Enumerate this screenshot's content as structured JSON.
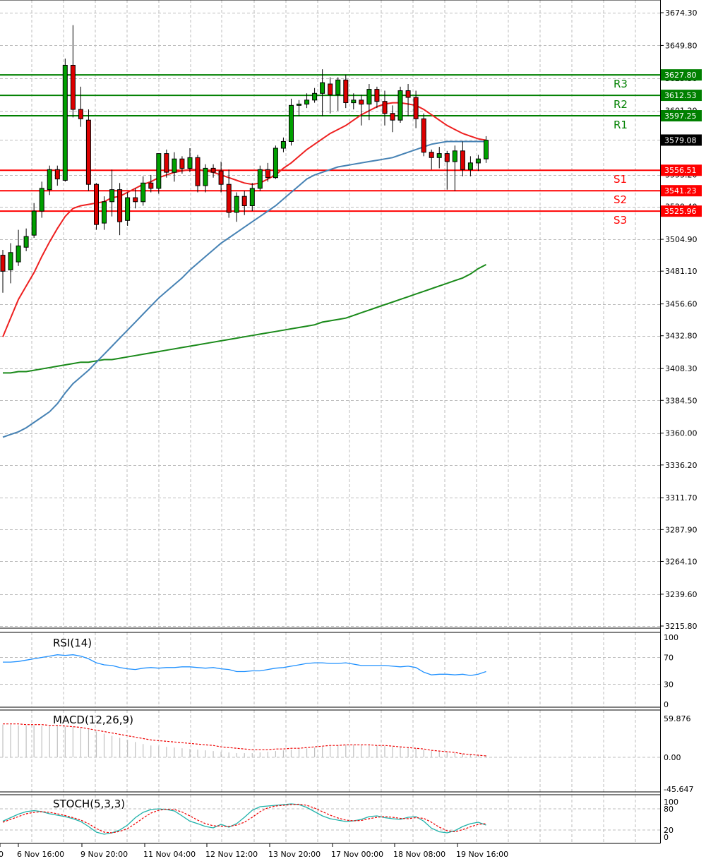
{
  "chart_data": {
    "type": "candlestick",
    "instrument_note": "",
    "time_axis_labels": [
      "0",
      "6 Nov 16:00",
      "9 Nov 20:00",
      "11 Nov 04:00",
      "12 Nov 12:00",
      "13 Nov 20:00",
      "17 Nov 00:00",
      "18 Nov 08:00",
      "19 Nov 16:00"
    ],
    "price_axis_labels": [
      "3674.30",
      "3649.80",
      "3625.30",
      "3601.20",
      "3579.08",
      "3553.20",
      "3529.40",
      "3504.90",
      "3481.10",
      "3456.60",
      "3432.80",
      "3408.30",
      "3384.50",
      "3360.00",
      "3336.20",
      "3311.70",
      "3287.90",
      "3264.10",
      "3239.60",
      "3215.80"
    ],
    "price_range": [
      3215.8,
      3674.3
    ],
    "current_price": {
      "label": "3579.08",
      "value": 3579.08
    },
    "levels": [
      {
        "name": "R3",
        "value": 3627.8,
        "label": "3627.80",
        "color": "#008000"
      },
      {
        "name": "R2",
        "value": 3612.53,
        "label": "3612.53",
        "color": "#008000"
      },
      {
        "name": "R1",
        "value": 3597.25,
        "label": "3597.25",
        "color": "#008000"
      },
      {
        "name": "S1",
        "value": 3556.51,
        "label": "3556.51",
        "color": "#ff0000"
      },
      {
        "name": "S2",
        "value": 3541.23,
        "label": "3541.23",
        "color": "#ff0000"
      },
      {
        "name": "S3",
        "value": 3525.96,
        "label": "3525.96",
        "color": "#ff0000"
      }
    ],
    "candles": [
      {
        "o": 3493,
        "h": 3497,
        "l": 3465,
        "c": 3481
      },
      {
        "o": 3482,
        "h": 3502,
        "l": 3472,
        "c": 3495
      },
      {
        "o": 3488,
        "h": 3512,
        "l": 3485,
        "c": 3500
      },
      {
        "o": 3499,
        "h": 3513,
        "l": 3496,
        "c": 3507
      },
      {
        "o": 3508,
        "h": 3532,
        "l": 3506,
        "c": 3526
      },
      {
        "o": 3526,
        "h": 3548,
        "l": 3521,
        "c": 3543
      },
      {
        "o": 3542,
        "h": 3560,
        "l": 3538,
        "c": 3557
      },
      {
        "o": 3557,
        "h": 3560,
        "l": 3545,
        "c": 3550
      },
      {
        "o": 3549,
        "h": 3640,
        "l": 3548,
        "c": 3635
      },
      {
        "o": 3635,
        "h": 3665,
        "l": 3596,
        "c": 3602
      },
      {
        "o": 3602,
        "h": 3619,
        "l": 3589,
        "c": 3595
      },
      {
        "o": 3594,
        "h": 3602,
        "l": 3541,
        "c": 3546
      },
      {
        "o": 3546,
        "h": 3547,
        "l": 3512,
        "c": 3516
      },
      {
        "o": 3517,
        "h": 3537,
        "l": 3512,
        "c": 3533
      },
      {
        "o": 3533,
        "h": 3557,
        "l": 3522,
        "c": 3542
      },
      {
        "o": 3542,
        "h": 3547,
        "l": 3508,
        "c": 3518
      },
      {
        "o": 3519,
        "h": 3540,
        "l": 3515,
        "c": 3536
      },
      {
        "o": 3536,
        "h": 3543,
        "l": 3528,
        "c": 3533
      },
      {
        "o": 3533,
        "h": 3552,
        "l": 3530,
        "c": 3547
      },
      {
        "o": 3547,
        "h": 3553,
        "l": 3540,
        "c": 3543
      },
      {
        "o": 3543,
        "h": 3560,
        "l": 3539,
        "c": 3569
      },
      {
        "o": 3569,
        "h": 3572,
        "l": 3551,
        "c": 3555
      },
      {
        "o": 3555,
        "h": 3570,
        "l": 3548,
        "c": 3565
      },
      {
        "o": 3565,
        "h": 3567,
        "l": 3554,
        "c": 3558
      },
      {
        "o": 3558,
        "h": 3573,
        "l": 3555,
        "c": 3566
      },
      {
        "o": 3566,
        "h": 3568,
        "l": 3540,
        "c": 3545
      },
      {
        "o": 3545,
        "h": 3561,
        "l": 3540,
        "c": 3558
      },
      {
        "o": 3558,
        "h": 3561,
        "l": 3551,
        "c": 3555
      },
      {
        "o": 3556,
        "h": 3563,
        "l": 3540,
        "c": 3546
      },
      {
        "o": 3546,
        "h": 3557,
        "l": 3521,
        "c": 3525
      },
      {
        "o": 3525,
        "h": 3540,
        "l": 3518,
        "c": 3537
      },
      {
        "o": 3537,
        "h": 3541,
        "l": 3523,
        "c": 3530
      },
      {
        "o": 3530,
        "h": 3547,
        "l": 3526,
        "c": 3543
      },
      {
        "o": 3543,
        "h": 3560,
        "l": 3541,
        "c": 3557
      },
      {
        "o": 3557,
        "h": 3562,
        "l": 3548,
        "c": 3551
      },
      {
        "o": 3551,
        "h": 3575,
        "l": 3550,
        "c": 3573
      },
      {
        "o": 3573,
        "h": 3581,
        "l": 3570,
        "c": 3578
      },
      {
        "o": 3578,
        "h": 3610,
        "l": 3575,
        "c": 3605
      },
      {
        "o": 3605,
        "h": 3609,
        "l": 3597,
        "c": 3606
      },
      {
        "o": 3606,
        "h": 3614,
        "l": 3603,
        "c": 3609
      },
      {
        "o": 3609,
        "h": 3618,
        "l": 3607,
        "c": 3614
      },
      {
        "o": 3614,
        "h": 3632,
        "l": 3597,
        "c": 3622
      },
      {
        "o": 3621,
        "h": 3626,
        "l": 3599,
        "c": 3613
      },
      {
        "o": 3613,
        "h": 3626,
        "l": 3601,
        "c": 3624
      },
      {
        "o": 3624,
        "h": 3628,
        "l": 3603,
        "c": 3607
      },
      {
        "o": 3607,
        "h": 3614,
        "l": 3602,
        "c": 3609
      },
      {
        "o": 3609,
        "h": 3613,
        "l": 3590,
        "c": 3606
      },
      {
        "o": 3606,
        "h": 3621,
        "l": 3594,
        "c": 3617
      },
      {
        "o": 3617,
        "h": 3619,
        "l": 3603,
        "c": 3608
      },
      {
        "o": 3608,
        "h": 3616,
        "l": 3590,
        "c": 3599
      },
      {
        "o": 3599,
        "h": 3605,
        "l": 3585,
        "c": 3594
      },
      {
        "o": 3594,
        "h": 3619,
        "l": 3592,
        "c": 3616
      },
      {
        "o": 3616,
        "h": 3621,
        "l": 3597,
        "c": 3611
      },
      {
        "o": 3611,
        "h": 3616,
        "l": 3588,
        "c": 3595
      },
      {
        "o": 3595,
        "h": 3599,
        "l": 3567,
        "c": 3570
      },
      {
        "o": 3570,
        "h": 3572,
        "l": 3557,
        "c": 3566
      },
      {
        "o": 3566,
        "h": 3574,
        "l": 3558,
        "c": 3569
      },
      {
        "o": 3569,
        "h": 3571,
        "l": 3542,
        "c": 3563
      },
      {
        "o": 3563,
        "h": 3575,
        "l": 3541,
        "c": 3571
      },
      {
        "o": 3571,
        "h": 3578,
        "l": 3552,
        "c": 3557
      },
      {
        "o": 3557,
        "h": 3567,
        "l": 3552,
        "c": 3562
      },
      {
        "o": 3562,
        "h": 3568,
        "l": 3556,
        "c": 3565
      },
      {
        "o": 3565,
        "h": 3582,
        "l": 3562,
        "c": 3579
      }
    ],
    "ma_red": [
      3432,
      3446,
      3460,
      3470,
      3480,
      3492,
      3503,
      3513,
      3522,
      3528,
      3530,
      3531,
      3532,
      3533,
      3536,
      3537,
      3540,
      3543,
      3546,
      3548,
      3551,
      3553,
      3555,
      3556,
      3557,
      3557,
      3556,
      3555,
      3553,
      3551,
      3549,
      3547,
      3546,
      3547,
      3550,
      3553,
      3558,
      3562,
      3567,
      3572,
      3576,
      3580,
      3584,
      3587,
      3590,
      3594,
      3598,
      3601,
      3604,
      3606,
      3607,
      3607,
      3606,
      3605,
      3602,
      3598,
      3594,
      3590,
      3587,
      3584,
      3582,
      3580,
      3579
    ],
    "ma_blue": [
      3357,
      3359,
      3361,
      3364,
      3368,
      3372,
      3376,
      3382,
      3390,
      3397,
      3402,
      3407,
      3413,
      3419,
      3425,
      3431,
      3437,
      3443,
      3449,
      3455,
      3461,
      3466,
      3471,
      3476,
      3482,
      3487,
      3492,
      3497,
      3502,
      3506,
      3510,
      3514,
      3518,
      3522,
      3526,
      3530,
      3535,
      3540,
      3545,
      3550,
      3553,
      3555,
      3557,
      3559,
      3560,
      3561,
      3562,
      3563,
      3564,
      3565,
      3566,
      3568,
      3570,
      3572,
      3574,
      3576,
      3577,
      3578,
      3578,
      3578,
      3578,
      3578,
      3578
    ],
    "ma_green": [
      3405,
      3405,
      3406,
      3406,
      3407,
      3408,
      3409,
      3410,
      3411,
      3412,
      3413,
      3413,
      3414,
      3415,
      3415,
      3416,
      3417,
      3418,
      3419,
      3420,
      3421,
      3422,
      3423,
      3424,
      3425,
      3426,
      3427,
      3428,
      3429,
      3430,
      3431,
      3432,
      3433,
      3434,
      3435,
      3436,
      3437,
      3438,
      3439,
      3440,
      3441,
      3443,
      3444,
      3445,
      3446,
      3448,
      3450,
      3452,
      3454,
      3456,
      3458,
      3460,
      3462,
      3464,
      3466,
      3468,
      3470,
      3472,
      3474,
      3476,
      3479,
      3483,
      3486
    ],
    "rsi": {
      "title": "RSI(14)",
      "axis_labels": [
        "100",
        "70",
        "30",
        "0"
      ],
      "values": [
        63,
        63,
        64,
        66,
        68,
        70,
        72,
        74,
        73,
        74,
        72,
        68,
        62,
        59,
        58,
        55,
        53,
        52,
        54,
        55,
        54,
        55,
        55,
        56,
        56,
        55,
        54,
        55,
        53,
        52,
        49,
        49,
        50,
        50,
        52,
        54,
        55,
        57,
        59,
        61,
        62,
        62,
        61,
        61,
        62,
        60,
        58,
        58,
        58,
        58,
        57,
        56,
        57,
        55,
        48,
        44,
        45,
        45,
        44,
        45,
        43,
        45,
        49
      ]
    },
    "macd": {
      "title": "MACD(12,26,9)",
      "axis_labels": [
        "59.876",
        "0.00",
        "-45.647"
      ],
      "histogram": [
        47,
        47,
        46,
        46,
        46,
        45,
        45,
        45,
        44,
        44,
        42,
        40,
        37,
        34,
        31,
        28,
        25,
        22,
        19,
        17,
        16,
        15,
        14,
        13,
        12,
        11,
        10,
        9,
        8,
        7,
        6,
        6,
        6,
        7,
        8,
        9,
        10,
        11,
        12,
        13,
        14,
        15,
        16,
        17,
        18,
        18,
        18,
        17,
        17,
        16,
        15,
        15,
        14,
        13,
        11,
        9,
        8,
        7,
        6,
        5,
        4,
        3,
        3
      ],
      "signal": [
        48,
        48,
        48,
        47,
        47,
        47,
        46,
        46,
        45,
        44,
        43,
        41,
        39,
        37,
        35,
        33,
        31,
        29,
        27,
        25,
        24,
        23,
        22,
        21,
        20,
        19,
        18,
        17,
        15,
        14,
        13,
        12,
        11,
        11,
        11,
        12,
        12,
        13,
        13,
        14,
        15,
        16,
        17,
        17,
        18,
        18,
        18,
        18,
        17,
        17,
        16,
        15,
        14,
        13,
        12,
        10,
        9,
        8,
        7,
        5,
        4,
        3,
        2
      ]
    },
    "stoch": {
      "title": "STOCH(5,3,3)",
      "axis_labels": [
        "100",
        "80",
        "20",
        "0"
      ],
      "k": [
        45,
        55,
        65,
        72,
        75,
        72,
        66,
        62,
        58,
        52,
        44,
        30,
        14,
        8,
        12,
        20,
        34,
        55,
        70,
        78,
        80,
        78,
        74,
        60,
        45,
        38,
        30,
        26,
        36,
        28,
        38,
        56,
        76,
        86,
        88,
        90,
        92,
        94,
        92,
        84,
        72,
        60,
        52,
        48,
        44,
        46,
        50,
        58,
        60,
        55,
        52,
        50,
        56,
        58,
        45,
        25,
        15,
        12,
        18,
        30,
        38,
        42,
        34
      ],
      "d": [
        42,
        50,
        58,
        66,
        70,
        72,
        70,
        66,
        61,
        55,
        48,
        38,
        24,
        14,
        12,
        16,
        24,
        38,
        54,
        68,
        76,
        79,
        78,
        71,
        60,
        48,
        38,
        32,
        31,
        30,
        34,
        42,
        56,
        72,
        83,
        88,
        90,
        92,
        93,
        90,
        82,
        72,
        62,
        54,
        48,
        46,
        47,
        52,
        56,
        58,
        56,
        53,
        52,
        55,
        53,
        42,
        28,
        18,
        15,
        21,
        29,
        36,
        38
      ]
    }
  }
}
